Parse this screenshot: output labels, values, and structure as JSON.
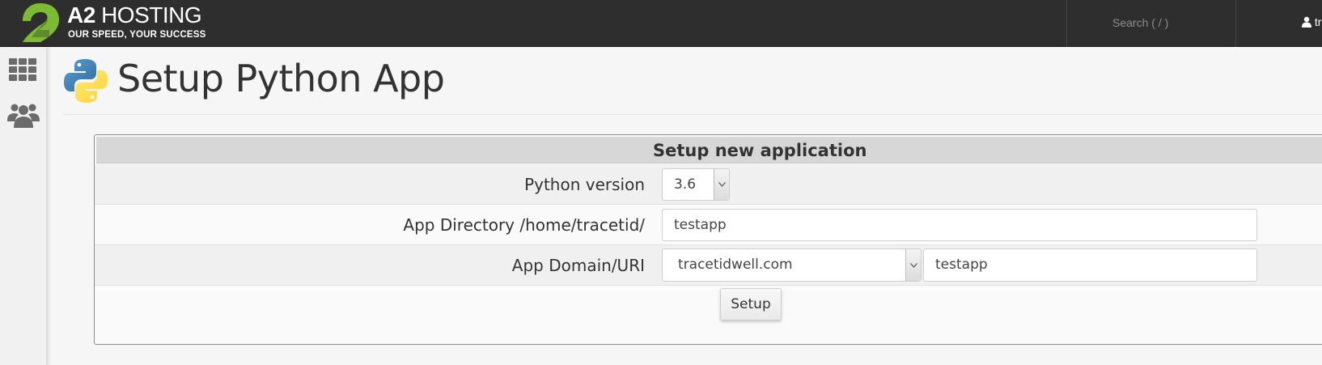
{
  "header": {
    "logo_title_bold": "A2",
    "logo_title_rest": " HOSTING",
    "logo_tagline": "OUR SPEED, YOUR SUCCESS",
    "search_placeholder": "Search ( / )",
    "user_name": "tr"
  },
  "sidebar": {
    "items": [
      {
        "icon": "grid-icon"
      },
      {
        "icon": "users-icon"
      }
    ]
  },
  "page": {
    "title": "Setup Python App",
    "icon": "python-icon"
  },
  "form": {
    "heading": "Setup new application",
    "python_version_label": "Python version",
    "python_version_value": "3.6",
    "app_directory_label": "App Directory /home/tracetid/",
    "app_directory_value": "testapp",
    "app_domain_label": "App Domain/URI",
    "app_domain_value": "tracetidwell.com",
    "app_uri_value": "testapp",
    "submit_label": "Setup"
  },
  "colors": {
    "topbar": "#2e2e2e",
    "logo_green": "#7dbb35",
    "panel_header": "#d7d7d7"
  }
}
